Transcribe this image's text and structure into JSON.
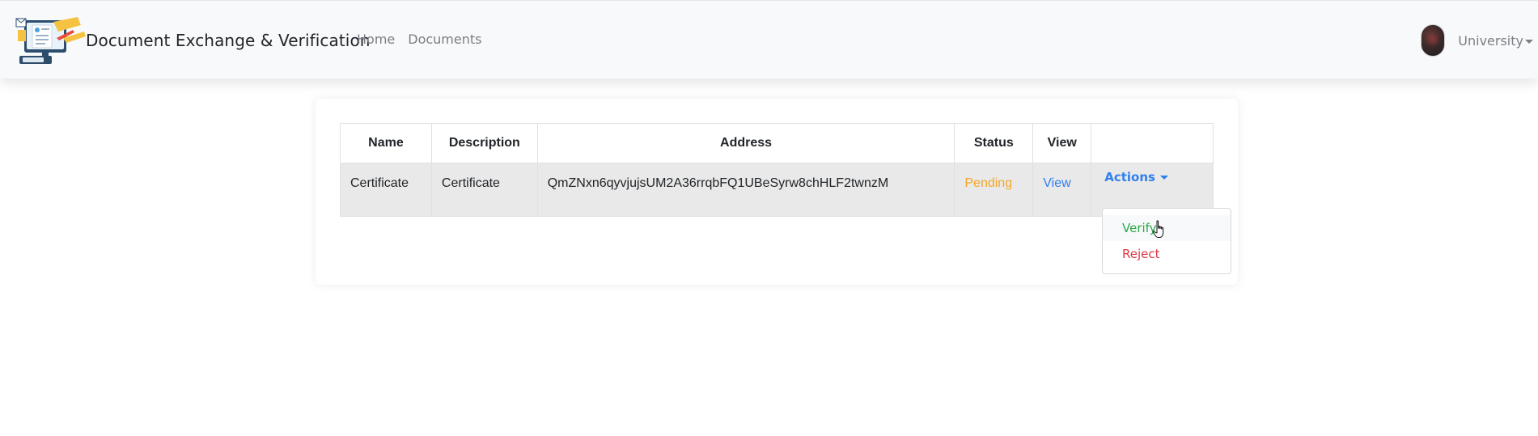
{
  "navbar": {
    "brand_text": "Document Exchange & Verification",
    "links": [
      "Home",
      "Documents"
    ],
    "user_label": "University"
  },
  "table": {
    "headers": [
      "Name",
      "Description",
      "Address",
      "Status",
      "View",
      ""
    ],
    "row": {
      "name": "Certificate",
      "description": "Certificate",
      "address": "QmZNxn6qyvjujsUM2A36rrqbFQ1UBeSyrw8chHLF2twnzM",
      "status": "Pending",
      "view": "View",
      "actions": "Actions"
    }
  },
  "dropdown": {
    "items": [
      "Verify",
      "Reject"
    ]
  },
  "colors": {
    "pending": "#f5a623",
    "link": "#2f80ed",
    "verify": "#28a745",
    "reject": "#dc3545"
  },
  "icons": {
    "brand": "document-computer-logo",
    "avatar": "user-avatar",
    "cursor": "hand-pointer-cursor"
  }
}
